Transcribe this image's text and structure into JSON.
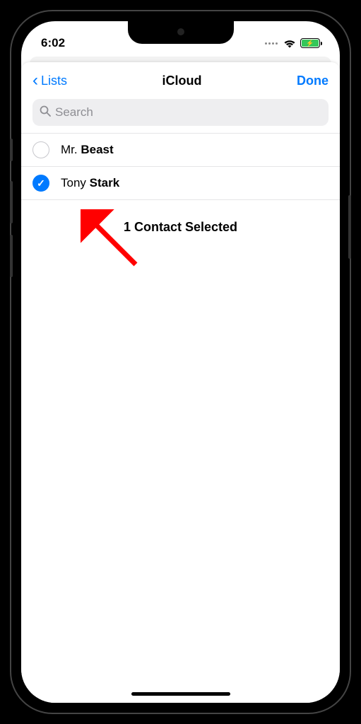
{
  "status": {
    "time": "6:02",
    "wifi": true,
    "battery_charging": true
  },
  "nav": {
    "back_label": "Lists",
    "title": "iCloud",
    "done_label": "Done"
  },
  "search": {
    "placeholder": "Search"
  },
  "contacts": [
    {
      "first": "Mr.",
      "last": "Beast",
      "selected": false
    },
    {
      "first": "Tony",
      "last": "Stark",
      "selected": true
    }
  ],
  "selection_summary": "1 Contact Selected",
  "colors": {
    "accent": "#007aff",
    "success": "#34c759",
    "annotation": "#ff0000"
  }
}
